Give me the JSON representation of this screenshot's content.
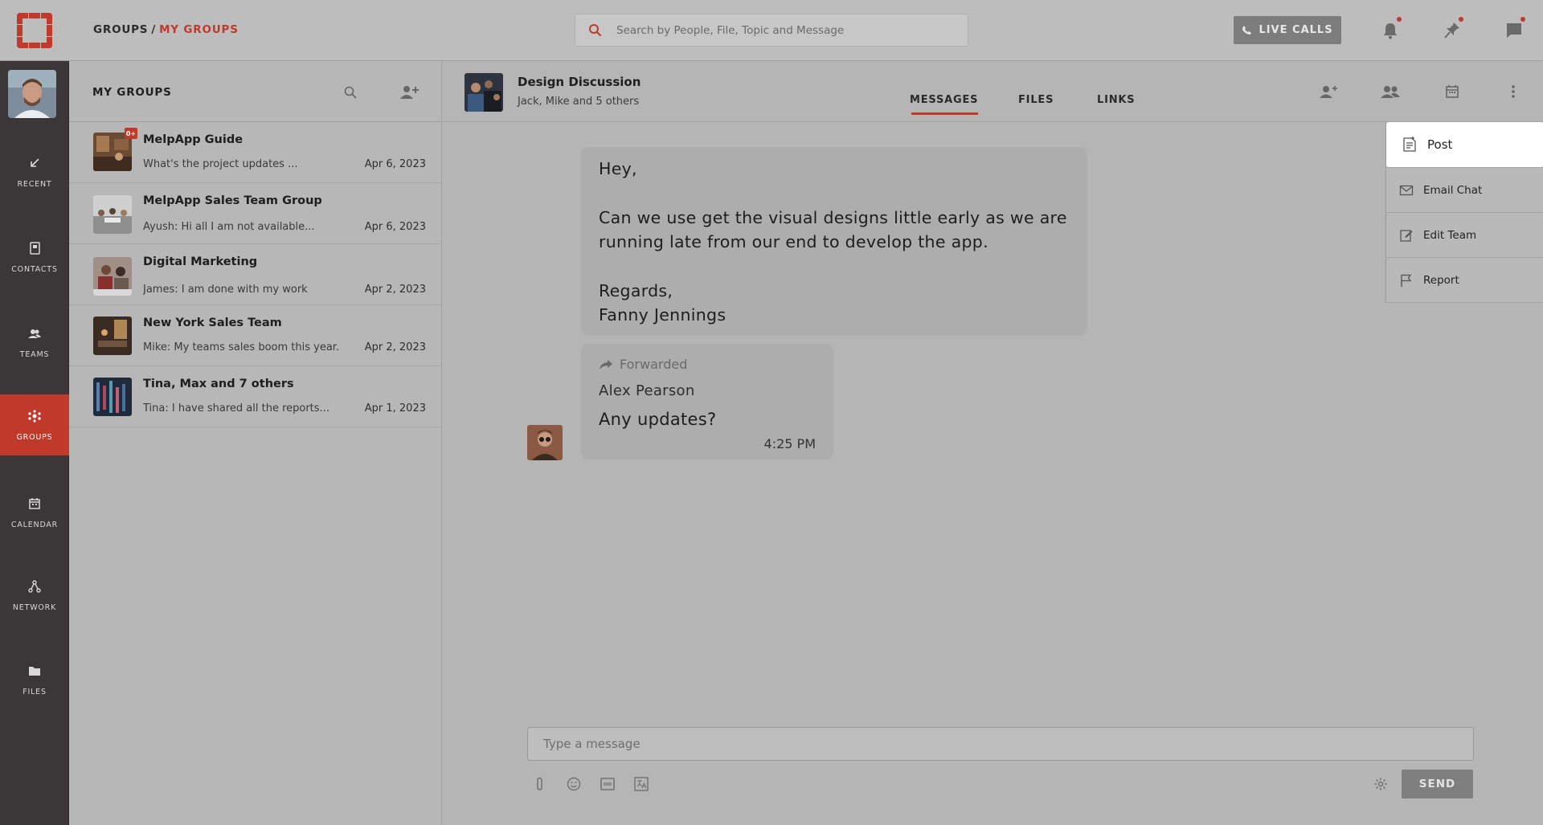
{
  "nav": {
    "items": [
      {
        "label": "RECENT",
        "icon": "arrow-down-left-icon"
      },
      {
        "label": "CONTACTS",
        "icon": "contacts-book-icon"
      },
      {
        "label": "TEAMS",
        "icon": "teams-icon"
      },
      {
        "label": "GROUPS",
        "icon": "groups-icon"
      },
      {
        "label": "CALENDAR",
        "icon": "calendar-icon"
      },
      {
        "label": "NETWORK",
        "icon": "network-icon"
      },
      {
        "label": "FILES",
        "icon": "folder-icon"
      }
    ],
    "active": "GROUPS"
  },
  "header": {
    "breadcrumb_root": "GROUPS",
    "breadcrumb_sep": "/",
    "breadcrumb_current": "MY GROUPS",
    "search_placeholder": "Search by People, File, Topic and Message",
    "live_calls_label": "LIVE CALLS"
  },
  "groups_panel": {
    "title": "MY GROUPS",
    "groups": [
      {
        "name": "MelpApp Guide",
        "preview": "What's the project updates ...",
        "date": "Apr 6, 2023",
        "badge": "0+"
      },
      {
        "name": "MelpApp Sales Team Group",
        "preview": "Ayush: Hi all I am not available...",
        "date": "Apr 6, 2023"
      },
      {
        "name": "Digital Marketing",
        "preview": "James: I am done with my work",
        "date": "Apr 2, 2023"
      },
      {
        "name": "New York Sales Team",
        "preview": "Mike: My teams sales boom this year.",
        "date": "Apr 2, 2023"
      },
      {
        "name": "Tina, Max and 7 others",
        "preview": "Tina: I have shared all the reports...",
        "date": "Apr 1, 2023"
      }
    ]
  },
  "chat": {
    "title": "Design Discussion",
    "subtitle": "Jack, Mike and 5 others",
    "tabs": [
      "MESSAGES",
      "FILES",
      "LINKS"
    ],
    "active_tab": "MESSAGES",
    "message1": {
      "greeting": "Hey,",
      "body": "Can we use get the visual designs little early as we are running late from our end to develop the app.",
      "closing": "Regards,",
      "signature": "Fanny Jennings"
    },
    "message2": {
      "forwarded_label": "Forwarded",
      "sender": "Alex Pearson",
      "text": "Any updates?",
      "time": "4:25 PM"
    },
    "composer_placeholder": "Type a message",
    "send_label": "SEND"
  },
  "menu": {
    "items": [
      "Post",
      "Email Chat",
      "Edit Team",
      "Report"
    ]
  },
  "colors": {
    "accent": "#c0392b",
    "rail": "#3b3637",
    "overlay_gray": "#b5b5b5"
  }
}
